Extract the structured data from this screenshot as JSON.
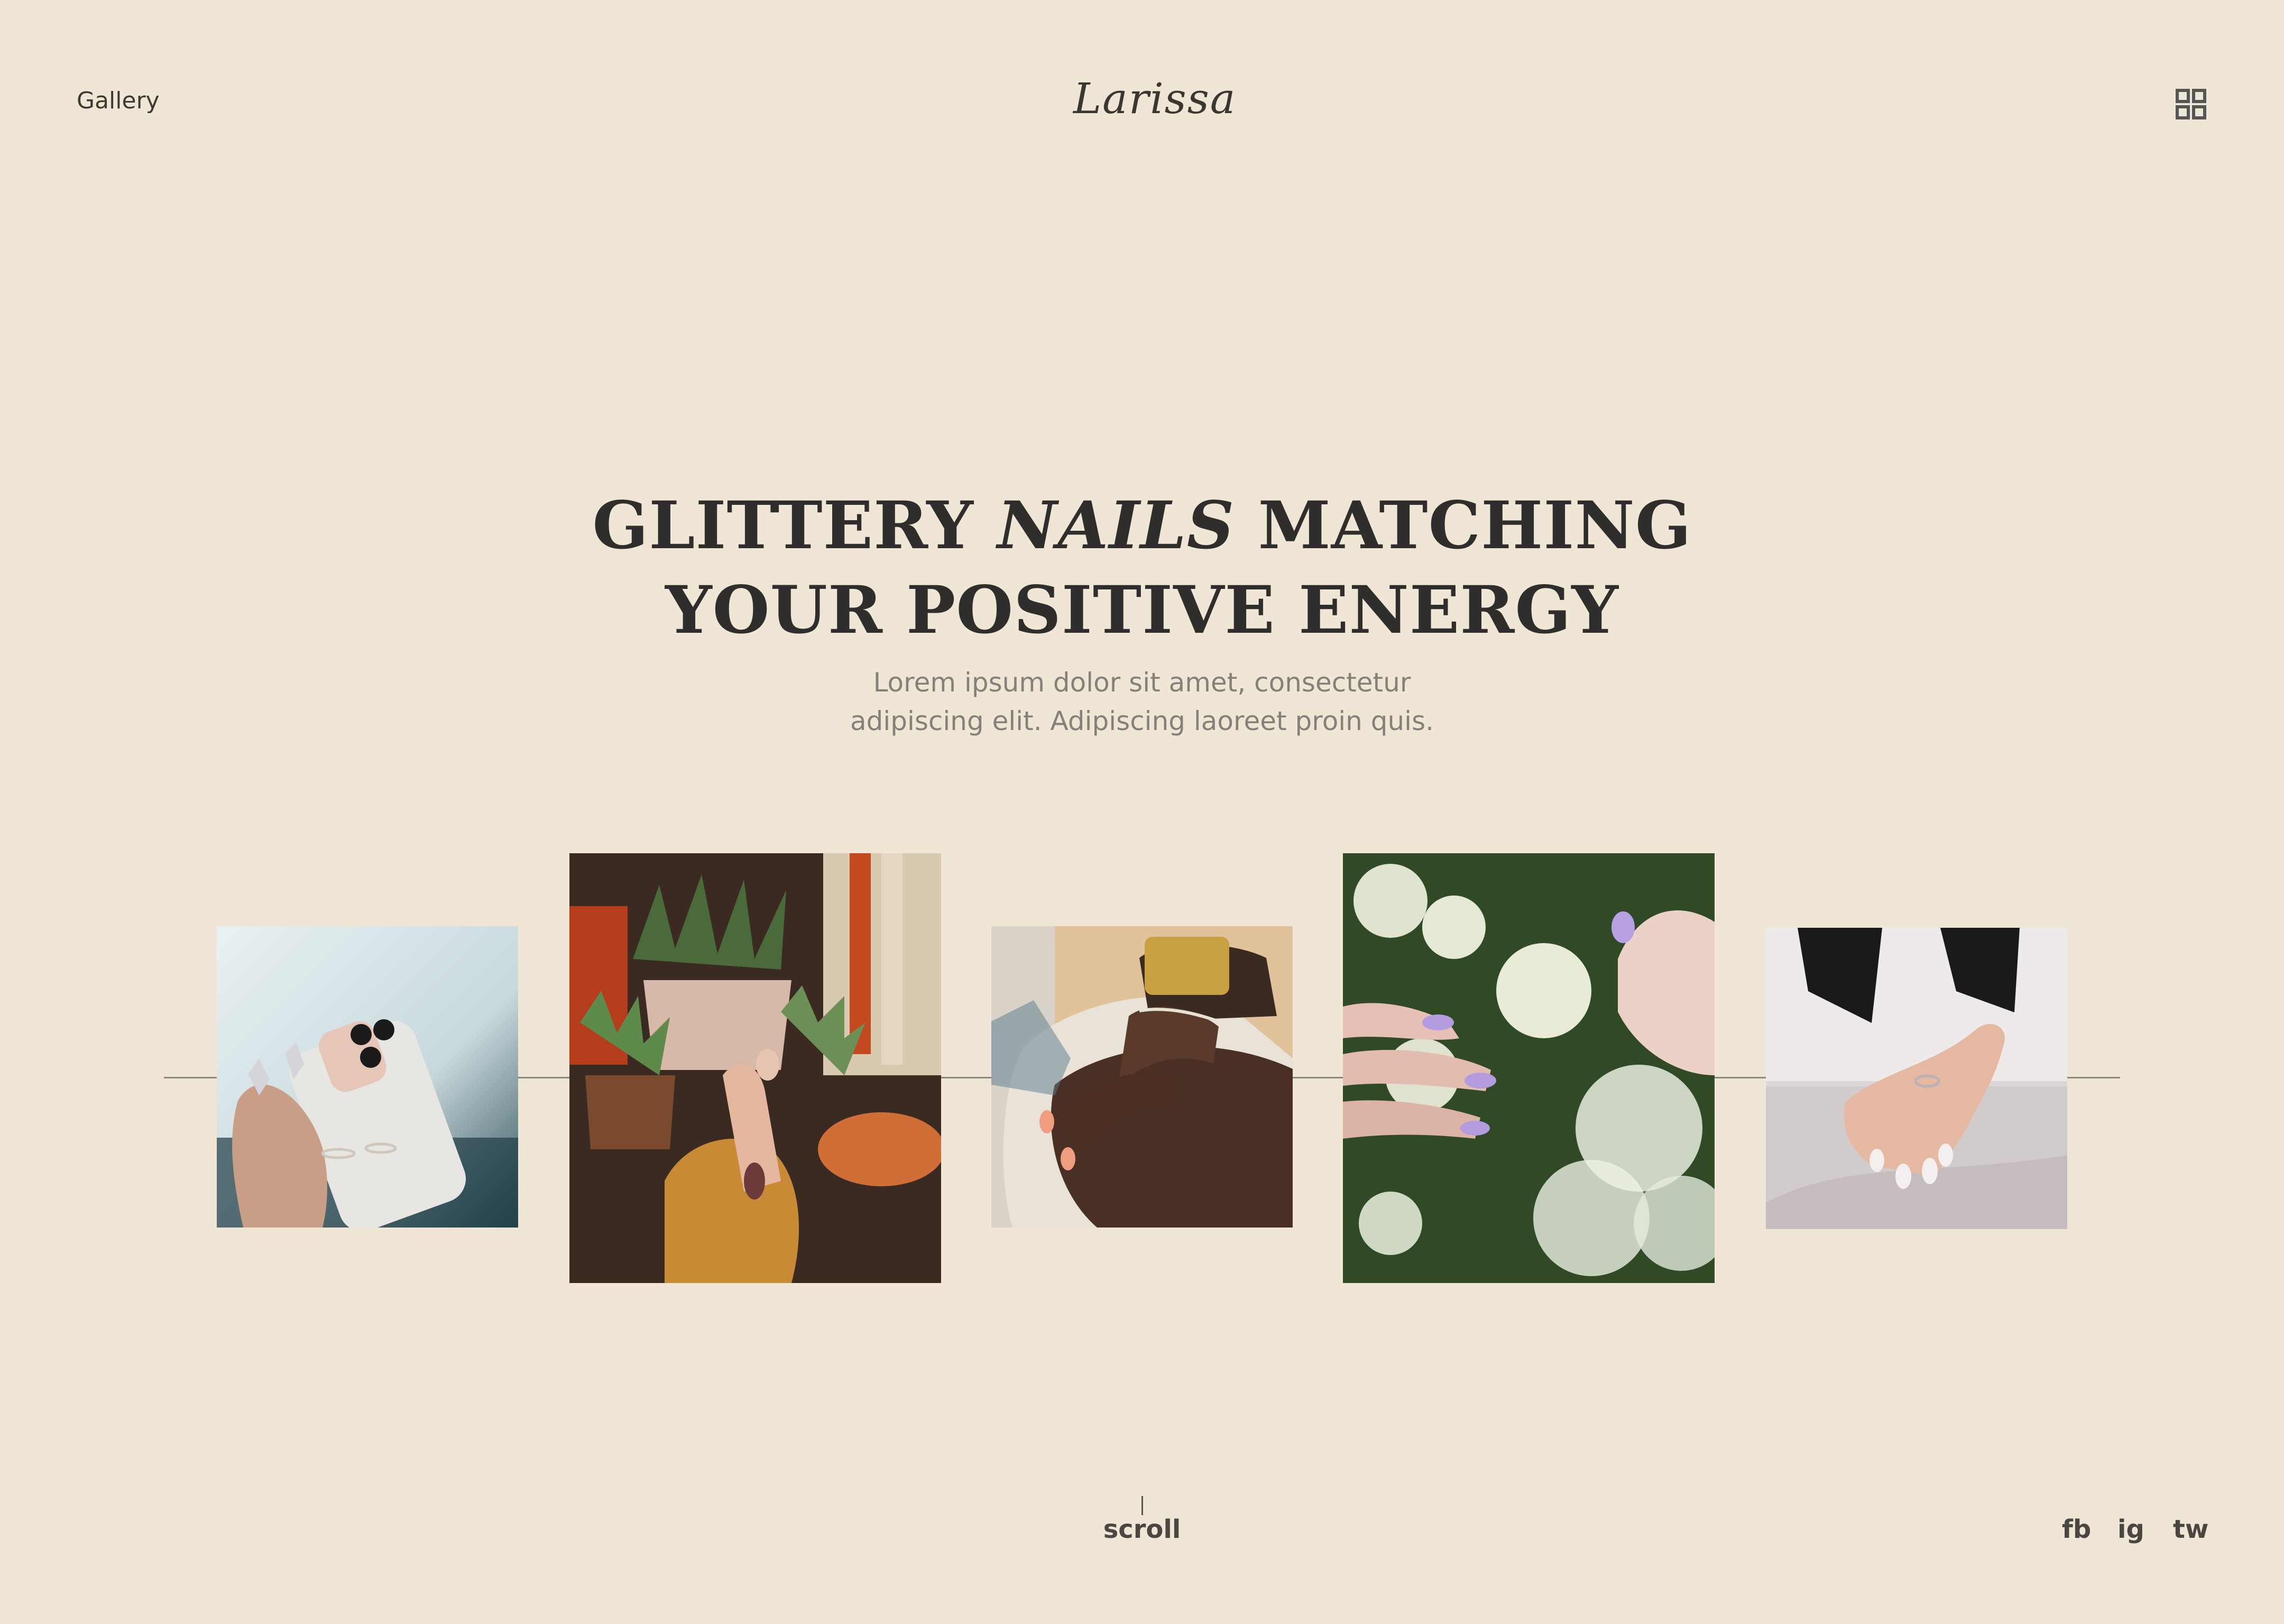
{
  "header": {
    "nav_label": "Gallery",
    "brand": "Larissa",
    "menu_icon": "grid-icon"
  },
  "hero": {
    "title_part1": "GLITTERY ",
    "title_accent": "NAILS",
    "title_part2": " MATCHING",
    "title_line2": "YOUR POSITIVE ENERGY",
    "subtitle_line1": "Lorem ipsum dolor sit amet, consectetur",
    "subtitle_line2": "adipiscing elit. Adipiscing laoreet proin quis."
  },
  "gallery": {
    "photos": [
      {
        "name": "hand-holding-phone-photo"
      },
      {
        "name": "hand-with-plants-photo"
      },
      {
        "name": "hand-with-bracelet-photo"
      },
      {
        "name": "hand-with-flowers-photo"
      },
      {
        "name": "hand-with-ring-photo"
      }
    ]
  },
  "footer": {
    "scroll_label": "scroll",
    "social": [
      "fb",
      "ig",
      "tw"
    ]
  },
  "colors": {
    "background": "#f0e6d6",
    "text_dark": "#302e2c",
    "text_muted": "#85807a"
  }
}
